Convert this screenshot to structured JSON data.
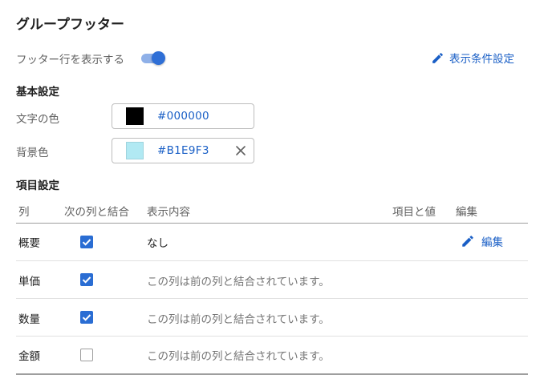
{
  "title": "グループフッター",
  "footer_toggle": {
    "label": "フッター行を表示する",
    "on": true
  },
  "condition_link": {
    "label": "表示条件設定",
    "icon": "pencil-icon"
  },
  "basic_settings": {
    "heading": "基本設定",
    "text_color": {
      "label": "文字の色",
      "value": "#000000",
      "swatch": "#000000"
    },
    "bg_color": {
      "label": "背景色",
      "value": "#B1E9F3",
      "swatch": "#B1E9F3"
    }
  },
  "item_settings": {
    "heading": "項目設定",
    "columns": [
      "列",
      "次の列と結合",
      "表示内容",
      "項目と値",
      "編集"
    ],
    "rows": [
      {
        "name": "概要",
        "merge": true,
        "content": "なし",
        "edit": "編集"
      },
      {
        "name": "単価",
        "merge": true,
        "content": "この列は前の列と結合されています。"
      },
      {
        "name": "数量",
        "merge": true,
        "content": "この列は前の列と結合されています。"
      },
      {
        "name": "金額",
        "merge": false,
        "content": "この列は前の列と結合されています。"
      }
    ]
  },
  "colors": {
    "accent": "#1a5fc6",
    "checkbox": "#2a6dd3"
  }
}
